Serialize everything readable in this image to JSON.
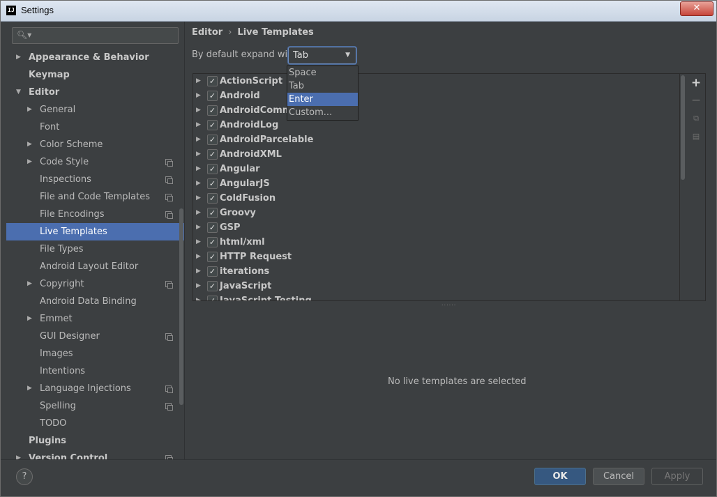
{
  "window": {
    "title": "Settings",
    "app_icon_text": "IJ",
    "close_icon": "close-icon"
  },
  "search": {
    "placeholder": "",
    "icon": "search-icon"
  },
  "sidebar": {
    "items": [
      {
        "label": "Appearance & Behavior",
        "level": 0,
        "arrow": "collapsed",
        "bold": true
      },
      {
        "label": "Keymap",
        "level": 0,
        "arrow": "none",
        "bold": true
      },
      {
        "label": "Editor",
        "level": 0,
        "arrow": "expanded",
        "bold": true
      },
      {
        "label": "General",
        "level": 1,
        "arrow": "collapsed"
      },
      {
        "label": "Font",
        "level": 1,
        "arrow": "none"
      },
      {
        "label": "Color Scheme",
        "level": 1,
        "arrow": "collapsed"
      },
      {
        "label": "Code Style",
        "level": 1,
        "arrow": "collapsed",
        "project_icon": true
      },
      {
        "label": "Inspections",
        "level": 1,
        "arrow": "none",
        "project_icon": true
      },
      {
        "label": "File and Code Templates",
        "level": 1,
        "arrow": "none",
        "project_icon": true
      },
      {
        "label": "File Encodings",
        "level": 1,
        "arrow": "none",
        "project_icon": true
      },
      {
        "label": "Live Templates",
        "level": 1,
        "arrow": "none",
        "selected": true
      },
      {
        "label": "File Types",
        "level": 1,
        "arrow": "none"
      },
      {
        "label": "Android Layout Editor",
        "level": 1,
        "arrow": "none"
      },
      {
        "label": "Copyright",
        "level": 1,
        "arrow": "collapsed",
        "project_icon": true
      },
      {
        "label": "Android Data Binding",
        "level": 1,
        "arrow": "none"
      },
      {
        "label": "Emmet",
        "level": 1,
        "arrow": "collapsed"
      },
      {
        "label": "GUI Designer",
        "level": 1,
        "arrow": "none",
        "project_icon": true
      },
      {
        "label": "Images",
        "level": 1,
        "arrow": "none"
      },
      {
        "label": "Intentions",
        "level": 1,
        "arrow": "none"
      },
      {
        "label": "Language Injections",
        "level": 1,
        "arrow": "collapsed",
        "project_icon": true
      },
      {
        "label": "Spelling",
        "level": 1,
        "arrow": "none",
        "project_icon": true
      },
      {
        "label": "TODO",
        "level": 1,
        "arrow": "none"
      },
      {
        "label": "Plugins",
        "level": 0,
        "arrow": "none",
        "bold": true
      },
      {
        "label": "Version Control",
        "level": 0,
        "arrow": "collapsed",
        "bold": true,
        "project_icon": true
      }
    ]
  },
  "breadcrumb": {
    "parent": "Editor",
    "separator": "›",
    "current": "Live Templates"
  },
  "expand": {
    "label": "By default expand with",
    "selected": "Tab",
    "options": [
      "Space",
      "Tab",
      "Enter",
      "Custom..."
    ],
    "highlighted": "Enter"
  },
  "templates": [
    {
      "name": "ActionScript",
      "checked": true
    },
    {
      "name": "Android",
      "checked": true
    },
    {
      "name": "AndroidComments",
      "checked": true
    },
    {
      "name": "AndroidLog",
      "checked": true
    },
    {
      "name": "AndroidParcelable",
      "checked": true
    },
    {
      "name": "AndroidXML",
      "checked": true
    },
    {
      "name": "Angular",
      "checked": true
    },
    {
      "name": "AngularJS",
      "checked": true
    },
    {
      "name": "ColdFusion",
      "checked": true
    },
    {
      "name": "Groovy",
      "checked": true
    },
    {
      "name": "GSP",
      "checked": true
    },
    {
      "name": "html/xml",
      "checked": true
    },
    {
      "name": "HTTP Request",
      "checked": true
    },
    {
      "name": "iterations",
      "checked": true
    },
    {
      "name": "JavaScript",
      "checked": true
    },
    {
      "name": "JavaScript Testing",
      "checked": true
    }
  ],
  "toolbar": {
    "add": "+",
    "remove": "−",
    "copy": "⧉",
    "doc": "▤"
  },
  "details": {
    "empty_message": "No live templates are selected"
  },
  "buttons": {
    "help": "?",
    "ok": "OK",
    "cancel": "Cancel",
    "apply": "Apply"
  },
  "colors": {
    "background": "#3c3f41",
    "selection": "#4b6eaf",
    "ok_button": "#365880"
  }
}
